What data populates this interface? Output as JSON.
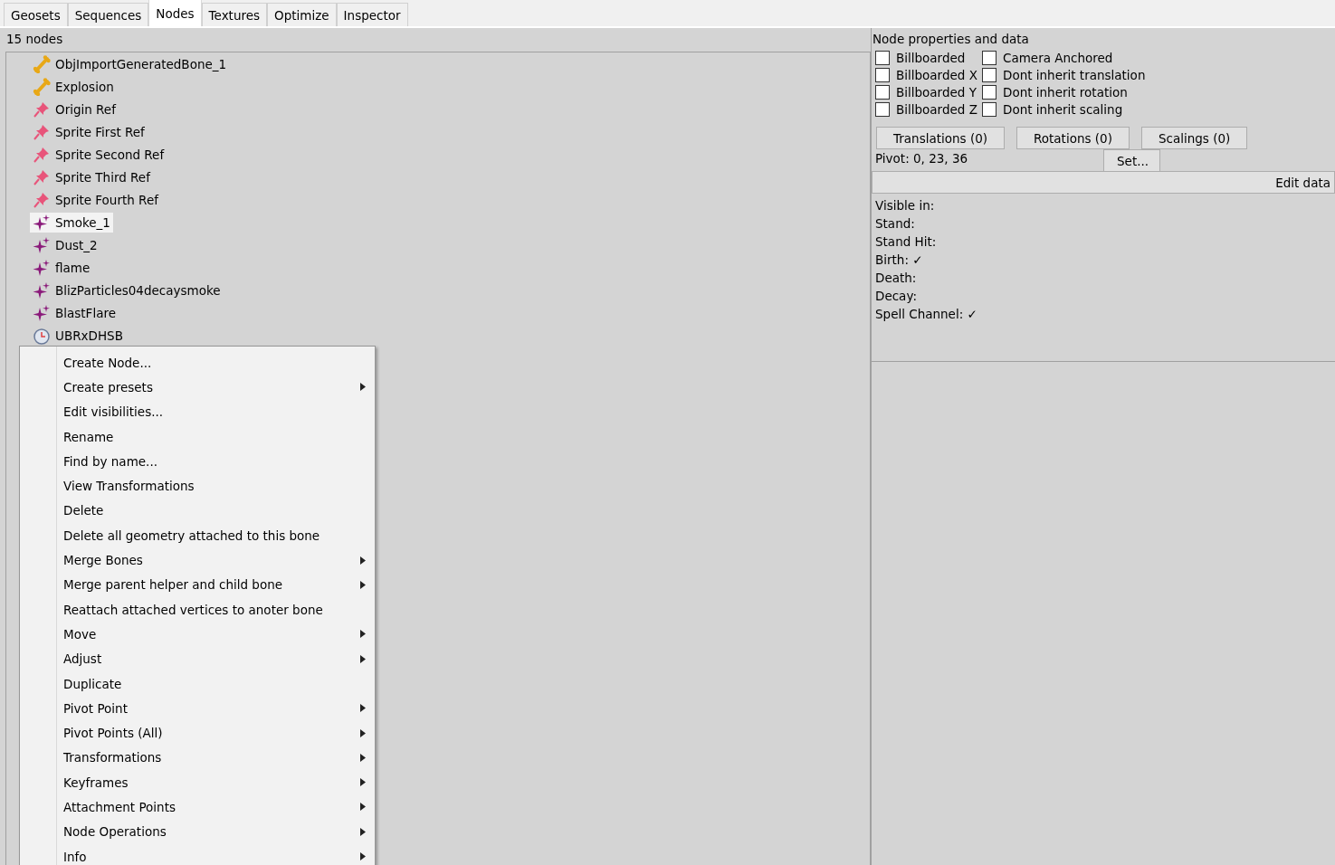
{
  "tabs": [
    {
      "label": "Geosets",
      "selected": false
    },
    {
      "label": "Sequences",
      "selected": false
    },
    {
      "label": "Nodes",
      "selected": true
    },
    {
      "label": "Textures",
      "selected": false
    },
    {
      "label": "Optimize",
      "selected": false
    },
    {
      "label": "Inspector",
      "selected": false
    }
  ],
  "node_count": "15 nodes",
  "nodes": [
    {
      "label": "ObjImportGeneratedBone_1",
      "kind": "bone",
      "selected": false
    },
    {
      "label": "Explosion",
      "kind": "bone",
      "selected": false
    },
    {
      "label": "Origin Ref",
      "kind": "attachment",
      "selected": false
    },
    {
      "label": "Sprite First Ref",
      "kind": "attachment",
      "selected": false
    },
    {
      "label": "Sprite Second Ref",
      "kind": "attachment",
      "selected": false
    },
    {
      "label": "Sprite Third Ref",
      "kind": "attachment",
      "selected": false
    },
    {
      "label": "Sprite Fourth Ref",
      "kind": "attachment",
      "selected": false
    },
    {
      "label": "Smoke_1",
      "kind": "particle",
      "selected": true
    },
    {
      "label": "Dust_2",
      "kind": "particle",
      "selected": false
    },
    {
      "label": "flame",
      "kind": "particle",
      "selected": false
    },
    {
      "label": "BlizParticles04decaysmoke",
      "kind": "particle",
      "selected": false
    },
    {
      "label": "BlastFlare",
      "kind": "particle",
      "selected": false
    },
    {
      "label": "UBRxDHSB",
      "kind": "event",
      "selected": false
    }
  ],
  "context_menu": [
    {
      "label": "Create Node...",
      "submenu": false
    },
    {
      "label": "Create presets",
      "submenu": true
    },
    {
      "label": "Edit visibilities...",
      "submenu": false
    },
    {
      "label": "Rename",
      "submenu": false
    },
    {
      "label": "Find by name...",
      "submenu": false
    },
    {
      "label": "View Transformations",
      "submenu": false
    },
    {
      "label": "Delete",
      "submenu": false
    },
    {
      "label": "Delete all geometry attached to this bone",
      "submenu": false
    },
    {
      "label": "Merge Bones",
      "submenu": true
    },
    {
      "label": "Merge parent helper and child bone",
      "submenu": true
    },
    {
      "label": "Reattach attached vertices to anoter bone",
      "submenu": false
    },
    {
      "label": "Move",
      "submenu": true
    },
    {
      "label": "Adjust",
      "submenu": true
    },
    {
      "label": "Duplicate",
      "submenu": false
    },
    {
      "label": "Pivot Point",
      "submenu": true
    },
    {
      "label": "Pivot Points (All)",
      "submenu": true
    },
    {
      "label": "Transformations",
      "submenu": true
    },
    {
      "label": "Keyframes",
      "submenu": true
    },
    {
      "label": "Attachment Points",
      "submenu": true
    },
    {
      "label": "Node Operations",
      "submenu": true
    },
    {
      "label": "Info",
      "submenu": true
    }
  ],
  "properties": {
    "title": "Node properties and data",
    "flags": [
      {
        "label": "Billboarded",
        "checked": false
      },
      {
        "label": "Camera Anchored",
        "checked": false
      },
      {
        "label": "Billboarded X",
        "checked": false
      },
      {
        "label": "Dont inherit translation",
        "checked": false
      },
      {
        "label": "Billboarded Y",
        "checked": false
      },
      {
        "label": "Dont inherit rotation",
        "checked": false
      },
      {
        "label": "Billboarded Z",
        "checked": false
      },
      {
        "label": "Dont inherit scaling",
        "checked": false
      }
    ],
    "buttons": [
      "Translations (0)",
      "Rotations (0)",
      "Scalings (0)"
    ],
    "pivot": "Pivot: 0, 23, 36",
    "set_button": "Set...",
    "edit_data": "Edit data",
    "visibility_lines": [
      "Visible in:",
      "Stand:",
      "Stand Hit:",
      "Birth: ✓",
      "Death:",
      "Decay:",
      "Spell Channel: ✓"
    ]
  }
}
